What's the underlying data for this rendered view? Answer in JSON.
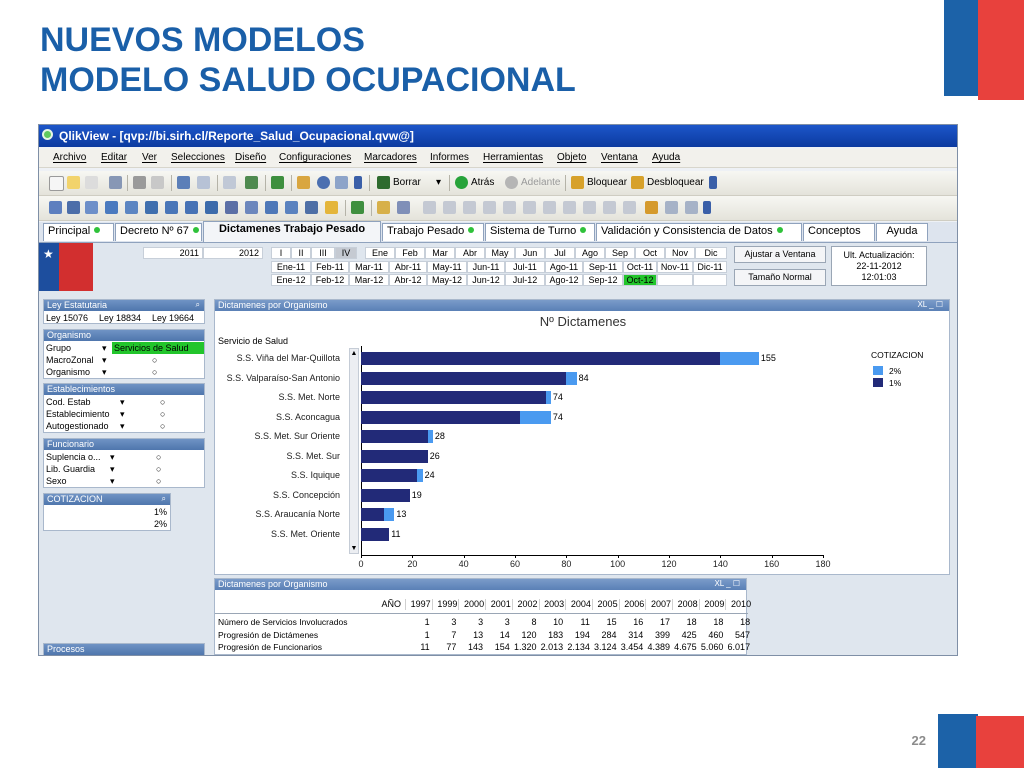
{
  "slide": {
    "title_line1": "NUEVOS MODELOS",
    "title_line2": "MODELO SALUD OCUPACIONAL",
    "page_number": "22"
  },
  "window": {
    "title": "QlikView - [qvp://bi.sirh.cl/Reporte_Salud_Ocupacional.qvw@]"
  },
  "menu": [
    "Archivo",
    "Editar",
    "Ver",
    "Selecciones",
    "Diseño",
    "Configuraciones",
    "Marcadores",
    "Informes",
    "Herramientas",
    "Objeto",
    "Ventana",
    "Ayuda"
  ],
  "toolbar": {
    "borrar": "Borrar",
    "atras": "Atrás",
    "adelante": "Adelante",
    "bloquear": "Bloquear",
    "desbloquear": "Desbloquear"
  },
  "tabs": [
    {
      "label": "Principal",
      "dot": true
    },
    {
      "label": "Decreto Nº 67",
      "dot": true
    },
    {
      "label": "Dictamenes Trabajo Pesado",
      "dot": false,
      "active": true
    },
    {
      "label": "Trabajo Pesado",
      "dot": true
    },
    {
      "label": "Sistema de Turno",
      "dot": true
    },
    {
      "label": "Validación y Consistencia de Datos",
      "dot": true
    },
    {
      "label": "Conceptos",
      "dot": false
    },
    {
      "label": "Ayuda",
      "dot": false
    }
  ],
  "filters": {
    "years": [
      "2011",
      "2012"
    ],
    "quarters": [
      "I",
      "II",
      "III",
      "IV"
    ],
    "months": [
      "Ene",
      "Feb",
      "Mar",
      "Abr",
      "May",
      "Jun",
      "Jul",
      "Ago",
      "Sep",
      "Oct",
      "Nov",
      "Dic"
    ],
    "period_row1": [
      "Ene-11",
      "Feb-11",
      "Mar-11",
      "Abr-11",
      "May-11",
      "Jun-11",
      "Jul-11",
      "Ago-11",
      "Sep-11",
      "Oct-11",
      "Nov-11",
      "Dic-11"
    ],
    "period_row2": [
      "Ene-12",
      "Feb-12",
      "Mar-12",
      "Abr-12",
      "May-12",
      "Jun-12",
      "Jul-12",
      "Ago-12",
      "Sep-12",
      "Oct-12"
    ],
    "selected_period": "Oct-12",
    "ajustar_label": "Ajustar a Ventana",
    "tamano_label": "Tamaño Normal",
    "update_label": "Ult. Actualización:",
    "update_date": "22-11-2012",
    "update_time": "12:01:03"
  },
  "left_panel": {
    "ley_header": "Ley Estatutaria",
    "leyes": [
      "Ley 15076",
      "Ley 18834",
      "Ley 19664"
    ],
    "organismo_header": "Organismo",
    "organismo_rows": [
      {
        "label": "Grupo",
        "value": "Servicios de Salud"
      },
      {
        "label": "MacroZonal",
        "value": ""
      },
      {
        "label": "Organismo",
        "value": ""
      }
    ],
    "establecimientos_header": "Establecimientos",
    "establecimientos_rows": [
      "Cod. Estab",
      "Establecimiento",
      "Autogestionado"
    ],
    "funcionario_header": "Funcionario",
    "funcionario_rows": [
      "Suplencia o...",
      "Lib. Guardia",
      "Sexo"
    ],
    "cotizacion_header": "COTIZACION",
    "cotizacion_values": [
      "1%",
      "2%"
    ],
    "procesos_header": "Procesos"
  },
  "chart_panel": {
    "header": "Dictamenes por Organismo",
    "dimension_label": "Servicio de Salud"
  },
  "chart_data": {
    "type": "bar",
    "orientation": "horizontal",
    "stacked": true,
    "title": "Nº Dictamenes",
    "categories": [
      "S.S. Viña del Mar-Quillota",
      "S.S. Valparaíso-San Antonio",
      "S.S. Met. Norte",
      "S.S. Aconcagua",
      "S.S. Met. Sur Oriente",
      "S.S. Met. Sur",
      "S.S. Iquique",
      "S.S. Concepción",
      "S.S. Araucanía Norte",
      "S.S. Met. Oriente"
    ],
    "totals": [
      155,
      84,
      74,
      74,
      28,
      26,
      24,
      19,
      13,
      11
    ],
    "series": [
      {
        "name": "1%",
        "color": "#222a78",
        "values": [
          140,
          80,
          72,
          62,
          26,
          26,
          22,
          19,
          9,
          11
        ]
      },
      {
        "name": "2%",
        "color": "#4a9af0",
        "values": [
          15,
          4,
          2,
          12,
          2,
          0,
          2,
          0,
          4,
          0
        ]
      }
    ],
    "legend_title": "COTIZACION",
    "legend_order": [
      "2%",
      "1%"
    ],
    "xlim": [
      0,
      180
    ],
    "xticks": [
      0,
      20,
      40,
      60,
      80,
      100,
      120,
      140,
      160,
      180
    ],
    "grid": false,
    "legend_position": "right"
  },
  "table_panel": {
    "header": "Dictamenes por Organismo",
    "year_label": "AÑO",
    "years": [
      "1997",
      "1999",
      "2000",
      "2001",
      "2002",
      "2003",
      "2004",
      "2005",
      "2006",
      "2007",
      "2008",
      "2009",
      "2010"
    ],
    "rows": [
      {
        "label": "Número de Servicios Involucrados",
        "values": [
          "1",
          "3",
          "3",
          "3",
          "8",
          "10",
          "11",
          "15",
          "16",
          "17",
          "18",
          "18",
          "18"
        ]
      },
      {
        "label": "Progresión de Dictámenes",
        "values": [
          "1",
          "7",
          "13",
          "14",
          "120",
          "183",
          "194",
          "284",
          "314",
          "399",
          "425",
          "460",
          "547"
        ]
      },
      {
        "label": "Progresión de Funcionarios",
        "values": [
          "11",
          "77",
          "143",
          "154",
          "1.320",
          "2.013",
          "2.134",
          "3.124",
          "3.454",
          "4.389",
          "4.675",
          "5.060",
          "6.017"
        ]
      }
    ]
  }
}
